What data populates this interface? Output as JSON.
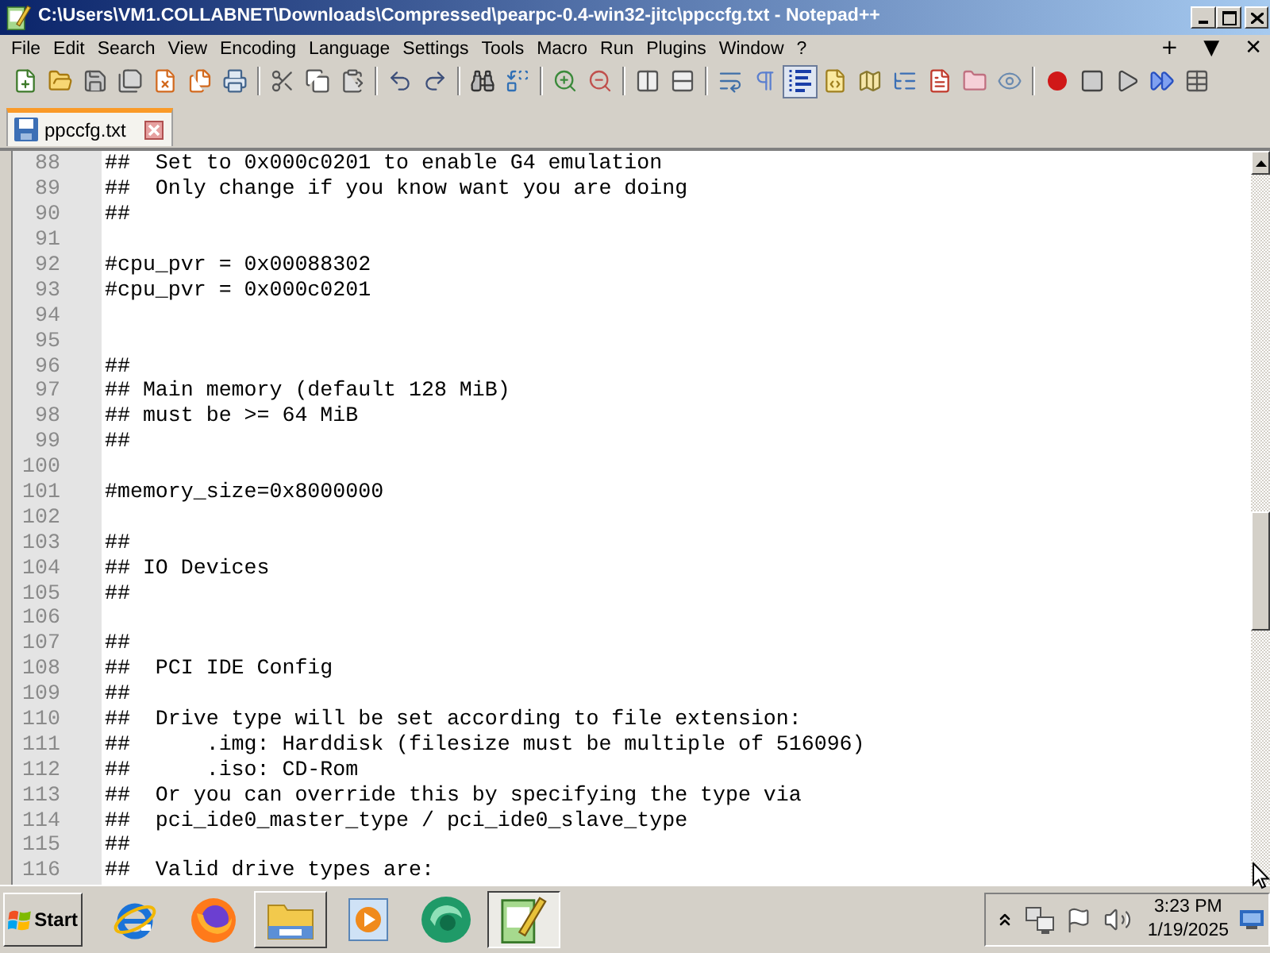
{
  "window": {
    "title": "C:\\Users\\VM1.COLLABNET\\Downloads\\Compressed\\pearpc-0.4-win32-jitc\\ppccfg.txt - Notepad++"
  },
  "menu": [
    "File",
    "Edit",
    "Search",
    "View",
    "Encoding",
    "Language",
    "Settings",
    "Tools",
    "Macro",
    "Run",
    "Plugins",
    "Window",
    "?"
  ],
  "menu_right": [
    "+",
    "▼",
    "✕"
  ],
  "toolbar": [
    [
      {
        "kind": "new",
        "pressed": false
      },
      {
        "kind": "open",
        "pressed": false
      },
      {
        "kind": "save",
        "pressed": false
      },
      {
        "kind": "saveall",
        "pressed": false
      },
      {
        "kind": "close",
        "pressed": false
      },
      {
        "kind": "closeall",
        "pressed": false
      },
      {
        "kind": "print",
        "pressed": false
      }
    ],
    [
      {
        "kind": "cut",
        "pressed": false
      },
      {
        "kind": "copy",
        "pressed": false
      },
      {
        "kind": "paste",
        "pressed": false
      }
    ],
    [
      {
        "kind": "undo",
        "pressed": false
      },
      {
        "kind": "redo",
        "pressed": false
      }
    ],
    [
      {
        "kind": "find",
        "pressed": false
      },
      {
        "kind": "replace",
        "pressed": false
      }
    ],
    [
      {
        "kind": "zoomin",
        "pressed": false
      },
      {
        "kind": "zoomout",
        "pressed": false
      }
    ],
    [
      {
        "kind": "syncv",
        "pressed": false
      },
      {
        "kind": "synch",
        "pressed": false
      }
    ],
    [
      {
        "kind": "wrap",
        "pressed": false
      },
      {
        "kind": "allchars",
        "pressed": false
      },
      {
        "kind": "indent",
        "pressed": true
      },
      {
        "kind": "udl",
        "pressed": false
      },
      {
        "kind": "docmap",
        "pressed": false
      },
      {
        "kind": "funclist",
        "pressed": false
      },
      {
        "kind": "doclist",
        "pressed": false
      },
      {
        "kind": "folder",
        "pressed": false
      },
      {
        "kind": "monitor",
        "pressed": false
      }
    ],
    [
      {
        "kind": "record",
        "pressed": false
      },
      {
        "kind": "stop",
        "pressed": false
      },
      {
        "kind": "play",
        "pressed": false
      },
      {
        "kind": "playmulti",
        "pressed": false
      },
      {
        "kind": "savemacro",
        "pressed": false
      }
    ]
  ],
  "tabs": [
    {
      "label": "ppccfg.txt",
      "selected": true
    }
  ],
  "editor": {
    "lines": [
      {
        "number": "88",
        "text": "##  Set to 0x000c0201 to enable G4 emulation"
      },
      {
        "number": "89",
        "text": "##  Only change if you know want you are doing"
      },
      {
        "number": "90",
        "text": "##"
      },
      {
        "number": "91"
      },
      {
        "number": "92",
        "text": "#cpu_pvr = 0x00088302"
      },
      {
        "number": "93",
        "text": "#cpu_pvr = 0x000c0201"
      },
      {
        "number": "94"
      },
      {
        "number": "95"
      },
      {
        "number": "96",
        "text": "##"
      },
      {
        "number": "97",
        "text": "## Main memory (default 128 MiB)"
      },
      {
        "number": "98",
        "text": "## must be >= 64 MiB"
      },
      {
        "number": "99",
        "text": "##"
      },
      {
        "number": "100"
      },
      {
        "number": "101",
        "text": "#memory_size=0x8000000"
      },
      {
        "number": "102"
      },
      {
        "number": "103",
        "text": "##"
      },
      {
        "number": "104",
        "text": "## IO Devices"
      },
      {
        "number": "105",
        "text": "##"
      },
      {
        "number": "106"
      },
      {
        "number": "107",
        "text": "##"
      },
      {
        "number": "108",
        "text": "##  PCI IDE Config"
      },
      {
        "number": "109",
        "text": "##"
      },
      {
        "number": "110",
        "text": "##  Drive type will be set according to file extension:"
      },
      {
        "number": "111",
        "text": "##      .img: Harddisk (filesize must be multiple of 516096)"
      },
      {
        "number": "112",
        "text": "##      .iso: CD-Rom"
      },
      {
        "number": "113",
        "text": "##  Or you can override this by specifying the type via"
      },
      {
        "number": "114",
        "text": "##  pci_ide0_master_type / pci_ide0_slave_type"
      },
      {
        "number": "115",
        "text": "##"
      },
      {
        "number": "116",
        "text": "##  Valid drive types are:"
      }
    ]
  },
  "taskbar": {
    "start": "Start",
    "apps": [
      {
        "kind": "ie",
        "running": false,
        "selected": false
      },
      {
        "kind": "firefox",
        "running": false,
        "selected": false
      },
      {
        "kind": "explorer",
        "running": true,
        "selected": false
      },
      {
        "kind": "media",
        "running": false,
        "selected": false
      },
      {
        "kind": "orb",
        "running": false,
        "selected": false
      },
      {
        "kind": "notepad",
        "running": true,
        "selected": true
      }
    ],
    "clock": {
      "time": "3:23 PM",
      "date": "1/19/2025"
    }
  }
}
